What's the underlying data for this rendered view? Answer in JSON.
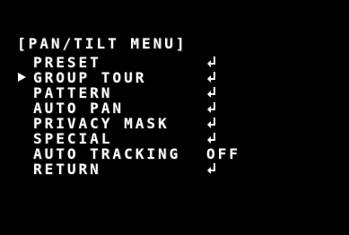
{
  "menu": {
    "title": "[PAN/TILT MENU]",
    "items": [
      {
        "label": "PRESET",
        "value": "",
        "icon": "enter-icon",
        "selected": false
      },
      {
        "label": "GROUP TOUR",
        "value": "",
        "icon": "enter-icon",
        "selected": true
      },
      {
        "label": "PATTERN",
        "value": "",
        "icon": "enter-icon",
        "selected": false
      },
      {
        "label": "AUTO PAN",
        "value": "",
        "icon": "enter-icon",
        "selected": false
      },
      {
        "label": "PRIVACY MASK",
        "value": "",
        "icon": "enter-icon",
        "selected": false
      },
      {
        "label": "SPECIAL",
        "value": "",
        "icon": "enter-icon",
        "selected": false
      },
      {
        "label": "AUTO TRACKING",
        "value": "OFF",
        "icon": "",
        "selected": false
      },
      {
        "label": "RETURN",
        "value": "",
        "icon": "enter-icon",
        "selected": false
      }
    ]
  },
  "colors": {
    "background": "#000000",
    "text": "#ffffff"
  }
}
